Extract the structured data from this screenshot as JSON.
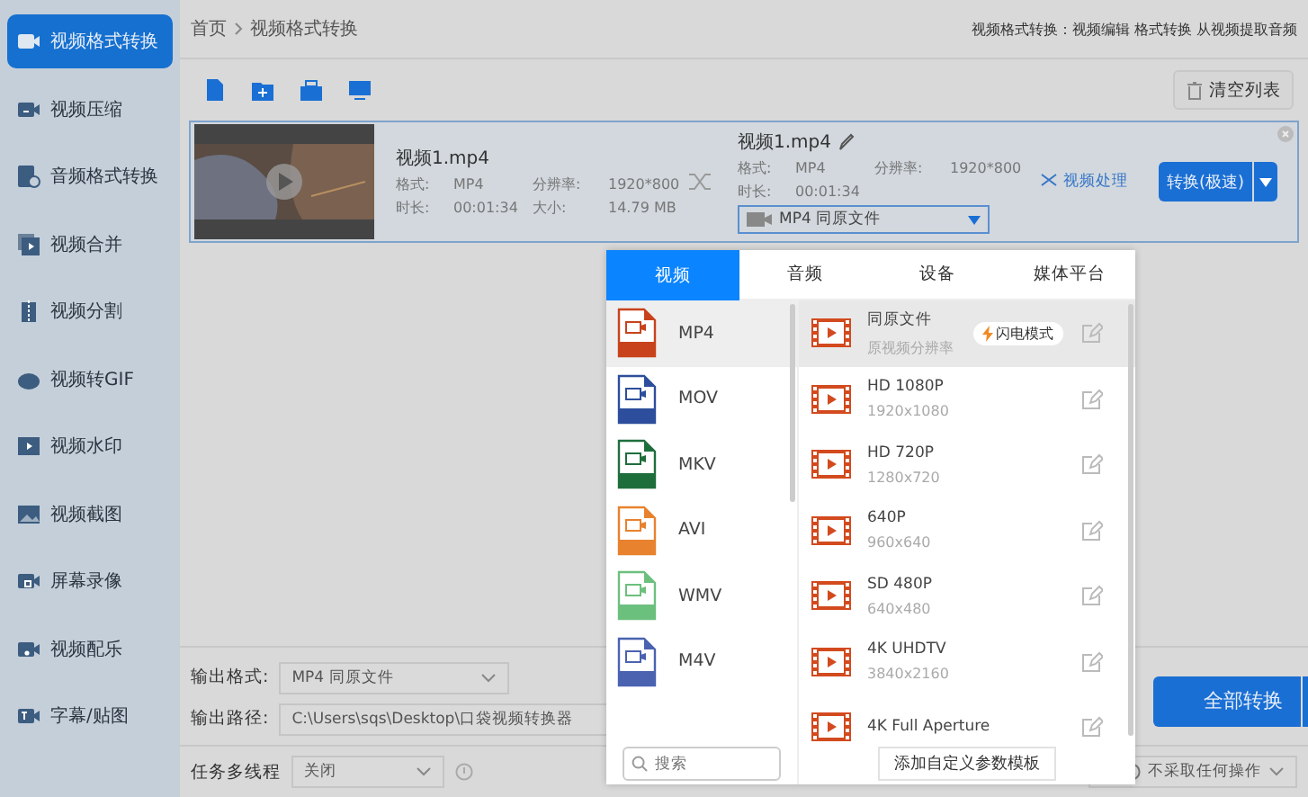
{
  "sidebar": {
    "items": [
      {
        "label": "视频格式转换",
        "selected": true
      },
      {
        "label": "视频压缩",
        "selected": false
      },
      {
        "label": "音频格式转换",
        "selected": false
      },
      {
        "label": "视频合并",
        "selected": false
      },
      {
        "label": "视频分割",
        "selected": false
      },
      {
        "label": "视频转GIF",
        "selected": false
      },
      {
        "label": "视频水印",
        "selected": false
      },
      {
        "label": "视频截图",
        "selected": false
      },
      {
        "label": "屏幕录像",
        "selected": false
      },
      {
        "label": "视频配乐",
        "selected": false
      },
      {
        "label": "字幕/贴图",
        "selected": false
      }
    ]
  },
  "breadcrumb": [
    "首页",
    "视频格式转换"
  ],
  "header_hint": "视频格式转换：视频编辑 格式转换 从视频提取音频",
  "clear_button": "清空列表",
  "file": {
    "source": {
      "name": "视频1.mp4",
      "format_label": "格式:",
      "format": "MP4",
      "resolution_label": "分辨率:",
      "resolution": "1920*800",
      "duration_label": "时长:",
      "duration": "00:01:34",
      "size_label": "大小:",
      "size": "14.79 MB"
    },
    "output": {
      "name": "视频1.mp4",
      "format_label": "格式:",
      "format": "MP4",
      "resolution_label": "分辨率:",
      "resolution": "1920*800",
      "duration_label": "时长:",
      "duration": "00:01:34",
      "preset": "MP4  同原文件"
    },
    "edit_link": "视频处理",
    "convert_button": "转换(极速)"
  },
  "popup": {
    "tabs": [
      {
        "label": "视频",
        "selected": true
      },
      {
        "label": "音频",
        "selected": false
      },
      {
        "label": "设备",
        "selected": false
      },
      {
        "label": "媒体平台",
        "selected": false
      }
    ],
    "formats": [
      {
        "label": "MP4",
        "color": "#c8431c",
        "selected": true
      },
      {
        "label": "MOV",
        "color": "#2d4e9c",
        "selected": false
      },
      {
        "label": "MKV",
        "color": "#1e6e3c",
        "selected": false
      },
      {
        "label": "AVI",
        "color": "#e8822e",
        "selected": false
      },
      {
        "label": "WMV",
        "color": "#6cc07e",
        "selected": false
      },
      {
        "label": "M4V",
        "color": "#4a62b0",
        "selected": false
      }
    ],
    "presets": [
      {
        "title": "同原文件",
        "detail": "原视频分辨率",
        "badge": "闪电模式",
        "selected": true
      },
      {
        "title": "HD 1080P",
        "detail": "1920x1080",
        "selected": false
      },
      {
        "title": "HD 720P",
        "detail": "1280x720",
        "selected": false
      },
      {
        "title": "640P",
        "detail": "960x640",
        "selected": false
      },
      {
        "title": "SD 480P",
        "detail": "640x480",
        "selected": false
      },
      {
        "title": "4K UHDTV",
        "detail": "3840x2160",
        "selected": false
      },
      {
        "title": "4K Full Aperture",
        "selected": false
      }
    ],
    "search_placeholder": "搜索",
    "add_template_button": "添加自定义参数模板"
  },
  "output_format_label": "输出格式:",
  "output_format": "MP4  同原文件",
  "output_path_label": "输出路径:",
  "output_path": "C:\\Users\\sqs\\Desktop\\口袋视频转换器",
  "convert_all_button": "全部转换",
  "threads_label": "任务多线程",
  "threads_value": "关闭",
  "after_action": "不采取任何操作"
}
